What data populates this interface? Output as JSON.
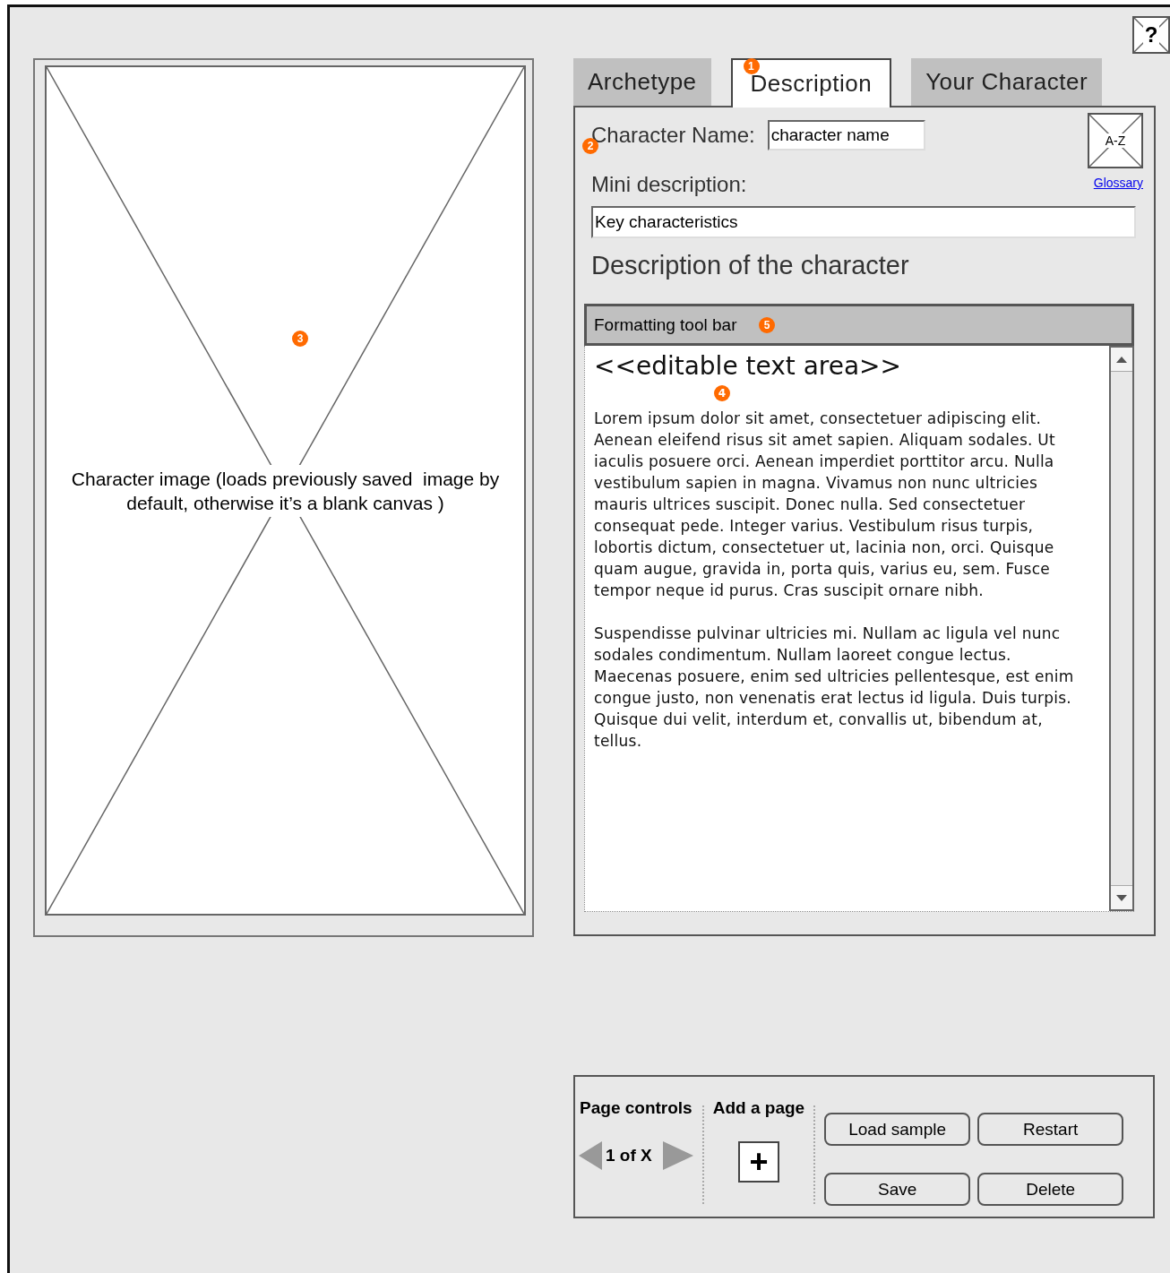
{
  "help_button": {
    "label": "?"
  },
  "image_panel": {
    "caption": "Character image (loads previously saved  image by default, otherwise it’s a blank canvas )",
    "callout": "3"
  },
  "tabs": [
    {
      "label": "Archetype",
      "selected": false
    },
    {
      "label": "Description",
      "selected": true,
      "callout": "1"
    },
    {
      "label": "Your Character",
      "selected": false
    }
  ],
  "form": {
    "name_label": "Character Name:",
    "name_value": "character name",
    "name_callout": "2",
    "glossary_icon": "A-Z",
    "glossary_link": "Glossary",
    "mini_label": "Mini description:",
    "mini_value": "Key characteristics",
    "description_heading": "Description of the character"
  },
  "editor": {
    "toolbar_label": "Formatting tool bar",
    "toolbar_callout": "5",
    "heading": "<<editable text area>>",
    "heading_callout": "4",
    "paragraphs": [
      "Lorem ipsum dolor sit amet, consectetuer adipiscing elit. Aenean eleifend risus sit amet sapien. Aliquam sodales. Ut iaculis posuere orci. Aenean imperdiet porttitor arcu. Nulla vestibulum sapien in magna. Vivamus non nunc ultricies mauris ultrices suscipit. Donec nulla. Sed consectetuer consequat pede. Integer varius. Vestibulum risus turpis, lobortis dictum, consectetuer ut, lacinia non, orci. Quisque quam augue, gravida in, porta quis, varius eu, sem. Fusce tempor neque id purus. Cras suscipit ornare nibh.",
      "Suspendisse pulvinar ultricies mi. Nullam ac ligula vel nunc sodales condimentum. Nullam laoreet congue lectus. Maecenas posuere, enim sed ultricies pellentesque, est enim congue justo, non venenatis erat lectus id ligula. Duis turpis. Quisque dui velit, interdum et, convallis ut, bibendum at, tellus."
    ]
  },
  "page_controls": {
    "title": "Page controls",
    "page_indicator": "1 of X",
    "add_title": "Add a page",
    "add_label": "+",
    "buttons": [
      "Load sample",
      "Restart",
      "Save",
      "Delete"
    ]
  }
}
